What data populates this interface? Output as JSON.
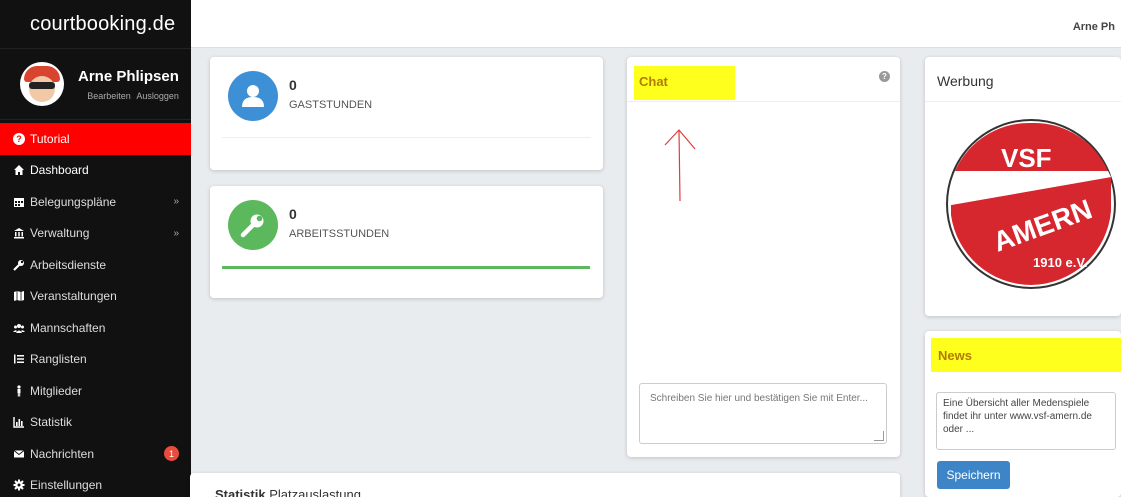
{
  "app": {
    "logo": "courtbooking.de"
  },
  "profile": {
    "name": "Arne Phlipsen",
    "edit_label": "Bearbeiten",
    "logout_label": "Ausloggen"
  },
  "topbar": {
    "user": "Arne Ph"
  },
  "sidebar": {
    "items": [
      {
        "label": "Tutorial",
        "icon": "question-circle-icon"
      },
      {
        "label": "Dashboard",
        "icon": "home-icon"
      },
      {
        "label": "Belegungspläne",
        "icon": "calendar-icon"
      },
      {
        "label": "Verwaltung",
        "icon": "bank-icon"
      },
      {
        "label": "Arbeitsdienste",
        "icon": "wrench-icon"
      },
      {
        "label": "Veranstaltungen",
        "icon": "map-icon"
      },
      {
        "label": "Mannschaften",
        "icon": "users-icon"
      },
      {
        "label": "Ranglisten",
        "icon": "list-icon"
      },
      {
        "label": "Mitglieder",
        "icon": "person-icon"
      },
      {
        "label": "Statistik",
        "icon": "chart-icon"
      },
      {
        "label": "Nachrichten",
        "icon": "envelope-icon",
        "badge": "1"
      },
      {
        "label": "Einstellungen",
        "icon": "gear-icon"
      }
    ]
  },
  "stats": {
    "guest": {
      "value": "0",
      "label": "GASTSTUNDEN",
      "color": "#3d8fd6",
      "icon": "user-icon"
    },
    "work": {
      "value": "0",
      "label": "ARBEITSSTUNDEN",
      "color": "#5cb85c",
      "icon": "wrench-icon",
      "progress": 1.0
    }
  },
  "chat": {
    "title": "Chat",
    "placeholder": "Schreiben Sie hier und bestätigen Sie mit Enter..."
  },
  "ad": {
    "title": "Werbung",
    "logo_text_top": "VSF",
    "logo_text_mid": "AMERN",
    "logo_text_bottom": "1910 e.V."
  },
  "news": {
    "title": "News",
    "text": "Eine Übersicht aller Medenspiele findet ihr unter www.vsf-amern.de oder ...",
    "save_label": "Speichern"
  },
  "bottom": {
    "title_bold": "Statistik",
    "title_rest": " Platzauslastung"
  },
  "colors": {
    "highlight": "#ffff1e",
    "active": "#ff0000",
    "sidebar": "#111111",
    "primary": "#3d85c6"
  }
}
